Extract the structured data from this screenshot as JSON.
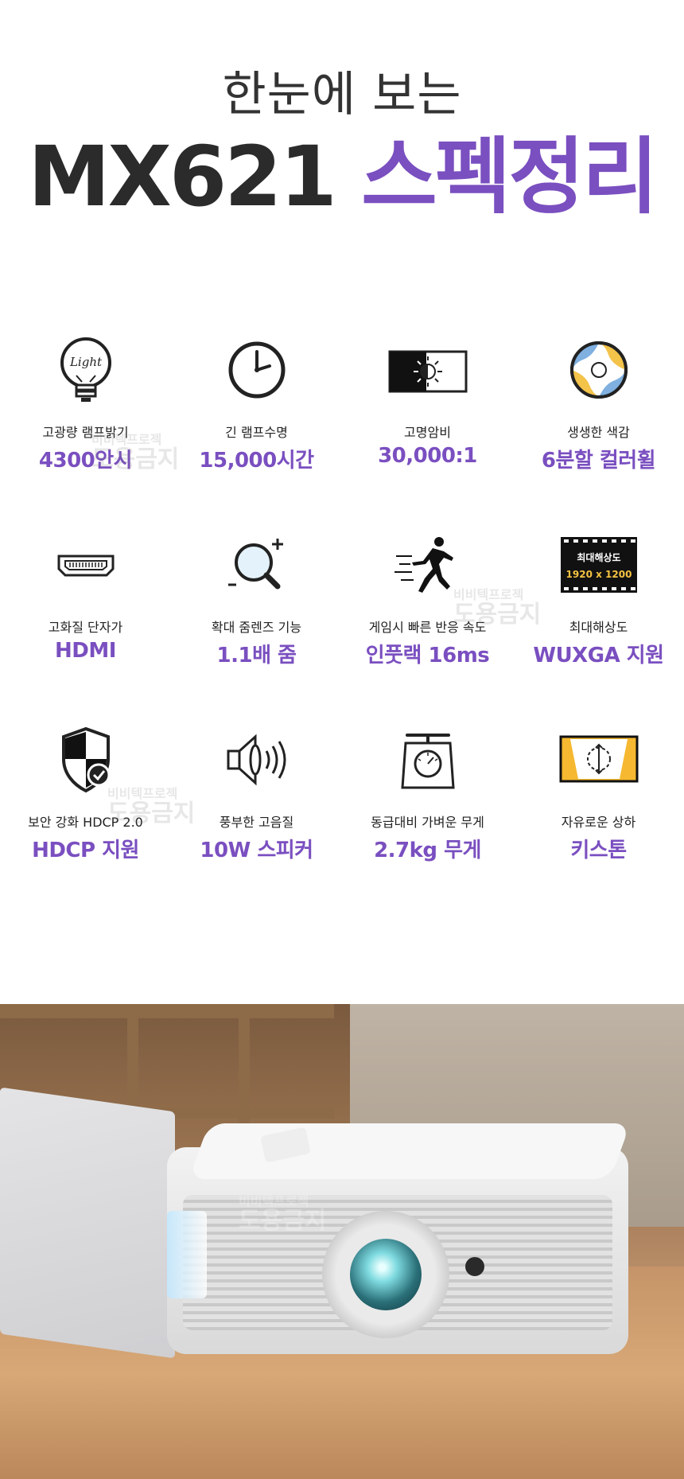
{
  "header": {
    "subtitle": "한눈에 보는",
    "model": "MX621",
    "title_accent": "스펙정리"
  },
  "specs": [
    {
      "icon": "lightbulb-icon",
      "icon_text": "Light",
      "label": "고광량 램프밝기",
      "value": "4300안시"
    },
    {
      "icon": "clock-icon",
      "label": "긴 램프수명",
      "value": "15,000시간"
    },
    {
      "icon": "contrast-icon",
      "label": "고명암비",
      "value": "30,000:1"
    },
    {
      "icon": "color-wheel-icon",
      "label": "생생한 색감",
      "value": "6분할 컬러휠"
    },
    {
      "icon": "hdmi-port-icon",
      "label": "고화질 단자가",
      "value": "HDMI"
    },
    {
      "icon": "zoom-lens-icon",
      "label": "확대 줌렌즈 기능",
      "value": "1.1배 줌"
    },
    {
      "icon": "running-man-icon",
      "label": "게임시 빠른 반응 속도",
      "value": "인풋랙 16ms"
    },
    {
      "icon": "film-resolution-icon",
      "icon_text_1": "최대해상도",
      "icon_text_2": "1920 x 1200",
      "label": "최대해상도",
      "value": "WUXGA 지원"
    },
    {
      "icon": "security-shield-icon",
      "label": "보안 강화 HDCP 2.0",
      "value": "HDCP 지원"
    },
    {
      "icon": "speaker-icon",
      "label": "풍부한 고음질",
      "value": "10W 스피커"
    },
    {
      "icon": "weighing-scale-icon",
      "label": "동급대비 가벼운 무게",
      "value": "2.7kg 무게"
    },
    {
      "icon": "keystone-icon",
      "label": "자유로운 상하",
      "value": "키스톤"
    }
  ],
  "watermark": {
    "line1": "비비텍프로젝",
    "line2": "도용금지"
  },
  "colors": {
    "accent": "#7a4fc0",
    "text": "#222222"
  }
}
